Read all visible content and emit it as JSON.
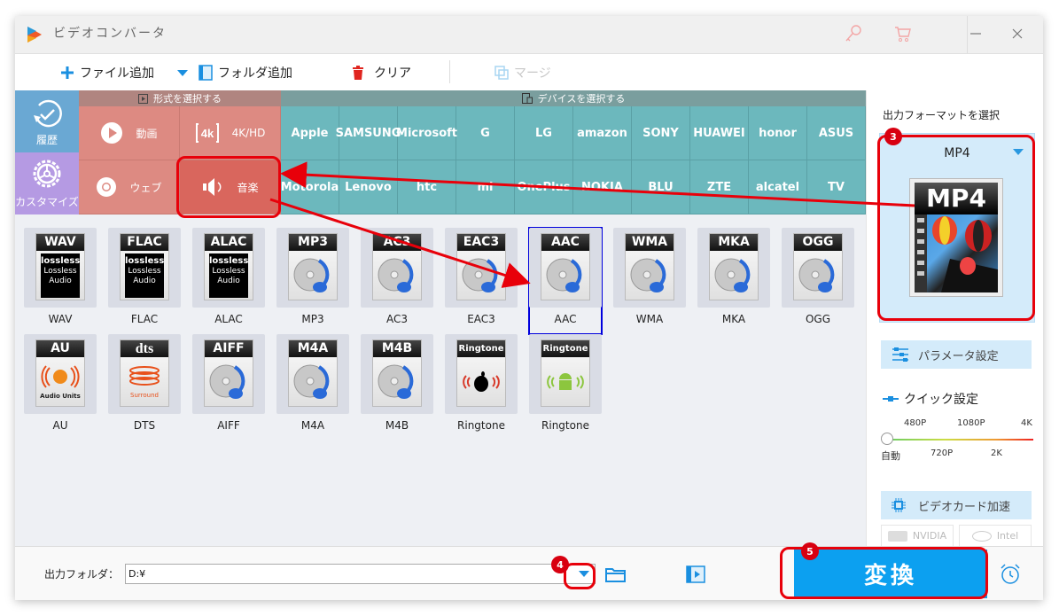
{
  "window": {
    "title": "ビデオコンバータ",
    "icons": [
      "key-icon",
      "cart-icon",
      "minimize-icon",
      "close-icon"
    ]
  },
  "toolbar": {
    "add_file": "ファイル追加",
    "add_folder": "フォルダ追加",
    "clear": "クリア",
    "merge": "マージ"
  },
  "left_tiles": {
    "history": "履歴",
    "customize": "カスタマイズ"
  },
  "format_section": {
    "header": "形式を選択する",
    "items": [
      {
        "label": "動画",
        "icon": "play-icon"
      },
      {
        "label": "4K/HD",
        "icon": "4k-icon"
      },
      {
        "label": "ウェブ",
        "icon": "chrome-icon"
      },
      {
        "label": "音楽",
        "icon": "speaker-icon"
      }
    ]
  },
  "device_section": {
    "header": "デバイスを選択する",
    "row1": [
      "Apple",
      "SAMSUNG",
      "Microsoft",
      "G",
      "LG",
      "amazon",
      "SONY",
      "HUAWEI",
      "honor",
      "ASUS"
    ],
    "row2": [
      "Motorola",
      "Lenovo",
      "htc",
      "mi",
      "OnePlus",
      "NOKIA",
      "BLU",
      "ZTE",
      "alcatel",
      "TV"
    ]
  },
  "audio_formats": [
    {
      "header": "WAV",
      "label": "WAV",
      "type": "lossless"
    },
    {
      "header": "FLAC",
      "label": "FLAC",
      "type": "lossless"
    },
    {
      "header": "ALAC",
      "label": "ALAC",
      "type": "lossless"
    },
    {
      "header": "MP3",
      "label": "MP3",
      "type": "disc"
    },
    {
      "header": "AC3",
      "label": "AC3",
      "type": "disc"
    },
    {
      "header": "EAC3",
      "label": "EAC3",
      "type": "disc"
    },
    {
      "header": "AAC",
      "label": "AAC",
      "type": "disc",
      "selected": true
    },
    {
      "header": "WMA",
      "label": "WMA",
      "type": "disc"
    },
    {
      "header": "MKA",
      "label": "MKA",
      "type": "disc"
    },
    {
      "header": "OGG",
      "label": "OGG",
      "type": "disc"
    },
    {
      "header": "AU",
      "label": "AU",
      "type": "au"
    },
    {
      "header": "dts",
      "label": "DTS",
      "type": "dts"
    },
    {
      "header": "AIFF",
      "label": "AIFF",
      "type": "disc"
    },
    {
      "header": "M4A",
      "label": "M4A",
      "type": "disc"
    },
    {
      "header": "M4B",
      "label": "M4B",
      "type": "disc"
    },
    {
      "header": "Ringtone",
      "label": "Ringtone",
      "type": "apple"
    },
    {
      "header": "Ringtone",
      "label": "Ringtone",
      "type": "android"
    }
  ],
  "icon_text": {
    "lossless_logo": "lossless",
    "lossless_sub1": "Lossless",
    "lossless_sub2": "Audio",
    "au_sub": "Audio Units",
    "dts_sub": "Surround"
  },
  "right_panel": {
    "title": "出力フォーマットを選択",
    "selected_format": "MP4",
    "thumb_label": "MP4",
    "param_button": "パラメータ設定",
    "quick_title": "クイック設定",
    "slider_top": [
      "480P",
      "1080P",
      "4K"
    ],
    "slider_bottom": [
      "自動",
      "720P",
      "2K"
    ],
    "slider_value": "自動",
    "gpu_button": "ビデオカード加速",
    "vendors": [
      "NVIDIA",
      "Intel"
    ]
  },
  "bottom": {
    "output_label": "出力フォルダ：",
    "output_value": "D:¥",
    "convert": "変換"
  },
  "annotations": {
    "badges": [
      "3",
      "4",
      "5"
    ],
    "color": "#e8000a"
  },
  "colors": {
    "accent": "#0ca0f0",
    "format_section": "#dd8a82",
    "device_section": "#6cb8bd",
    "history_tile": "#6aa8d3",
    "customize_tile": "#b59ae3",
    "selection_outline": "#0000dd"
  }
}
